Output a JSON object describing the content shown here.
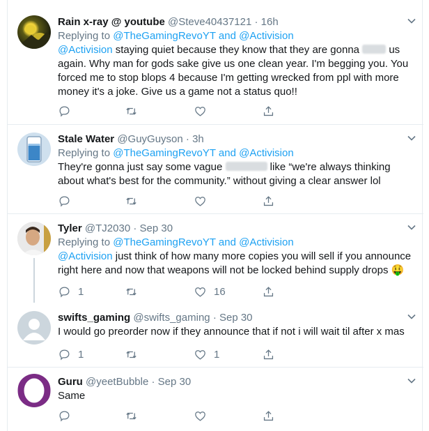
{
  "tweets": [
    {
      "name": "Rain x-ray @ youtube",
      "handle": "@Steve40437121",
      "time": "16h",
      "replying_prefix": "Replying to",
      "replying_users": "@TheGamingRevoYT and @Activision",
      "mention": "@Activision",
      "text_line1a": " staying quiet because they know that they are gonna",
      "text_line1b": " us",
      "text_rest": "again. Why man for gods sake give us one clean year. I'm begging you. You forced me to stop blops 4 because I'm getting wrecked from ppl with more money it's a joke. Give us a game not a status quo!!",
      "reply_count": "",
      "retweet_count": "",
      "like_count": ""
    },
    {
      "name": "Stale Water",
      "handle": "@GuyGuyson",
      "time": "3h",
      "replying_prefix": "Replying to",
      "replying_users": "@TheGamingRevoYT and @Activision",
      "text_part1": "They're gonna just say some vague ",
      "text_part2": " like “we're always thinking about what's best for the community.” without giving a clear answer lol"
    },
    {
      "name": "Tyler",
      "handle": "@TJ2030",
      "time": "Sep 30",
      "replying_prefix": "Replying to",
      "replying_users": "@TheGamingRevoYT and @Activision",
      "mention": "@Activision",
      "text": " just think of how many more copies you will sell if you announce right here and now that weapons will not be locked behind supply drops 🤑",
      "reply_count": "1",
      "like_count": "16"
    },
    {
      "name": "swifts_gaming",
      "handle": "@swifts_gaming",
      "time": "Sep 30",
      "text": "I would go preorder now if they announce that if not i will wait til after x mas",
      "reply_count": "1",
      "like_count": "1"
    },
    {
      "name": "Guru",
      "handle": "@yeetBubble",
      "time": "Sep 30",
      "text": "Same",
      "avatar_letter": "O"
    }
  ],
  "separator": "·",
  "colors": {
    "link": "#1da1f2",
    "meta": "#657786",
    "guru_ring": "#7b2c85"
  },
  "icons": [
    "reply-icon",
    "retweet-icon",
    "like-icon",
    "share-icon",
    "chevron-down-icon"
  ]
}
